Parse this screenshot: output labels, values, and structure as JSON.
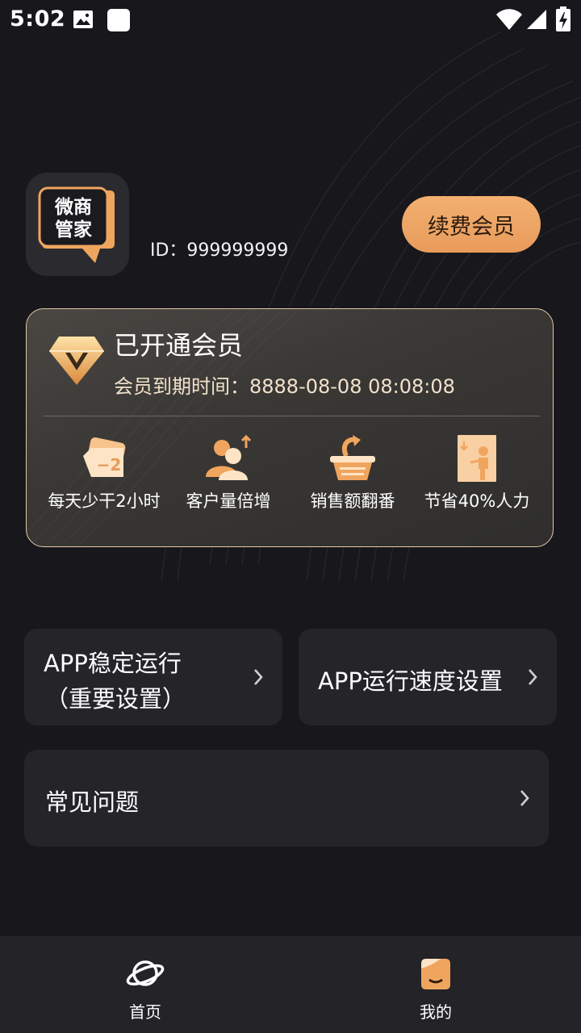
{
  "status_bar": {
    "time": "5:02"
  },
  "profile": {
    "logo_text_line1": "微商",
    "logo_text_line2": "管家",
    "id_label": "ID：999999999",
    "renew_button": "续费会员"
  },
  "membership": {
    "title": "已开通会员",
    "expiry": "会员到期时间：8888-08-08 08:08:08",
    "benefits": [
      {
        "label": "每天少干2小时",
        "icon": "clock-minus-2-icon",
        "badge": "−2"
      },
      {
        "label": "客户量倍增",
        "icon": "customers-up-icon"
      },
      {
        "label": "销售额翻番",
        "icon": "sales-basket-icon"
      },
      {
        "label": "节省40%人力",
        "icon": "save-labor-icon"
      }
    ]
  },
  "settings": {
    "stable_line1": "APP稳定运行",
    "stable_line2": "（重要设置）",
    "speed": "APP运行速度设置",
    "faq": "常见问题"
  },
  "nav": {
    "home": "首页",
    "mine": "我的"
  },
  "colors": {
    "background": "#17171c",
    "accent": "#eda364",
    "card_border": "#e3c9a6"
  }
}
